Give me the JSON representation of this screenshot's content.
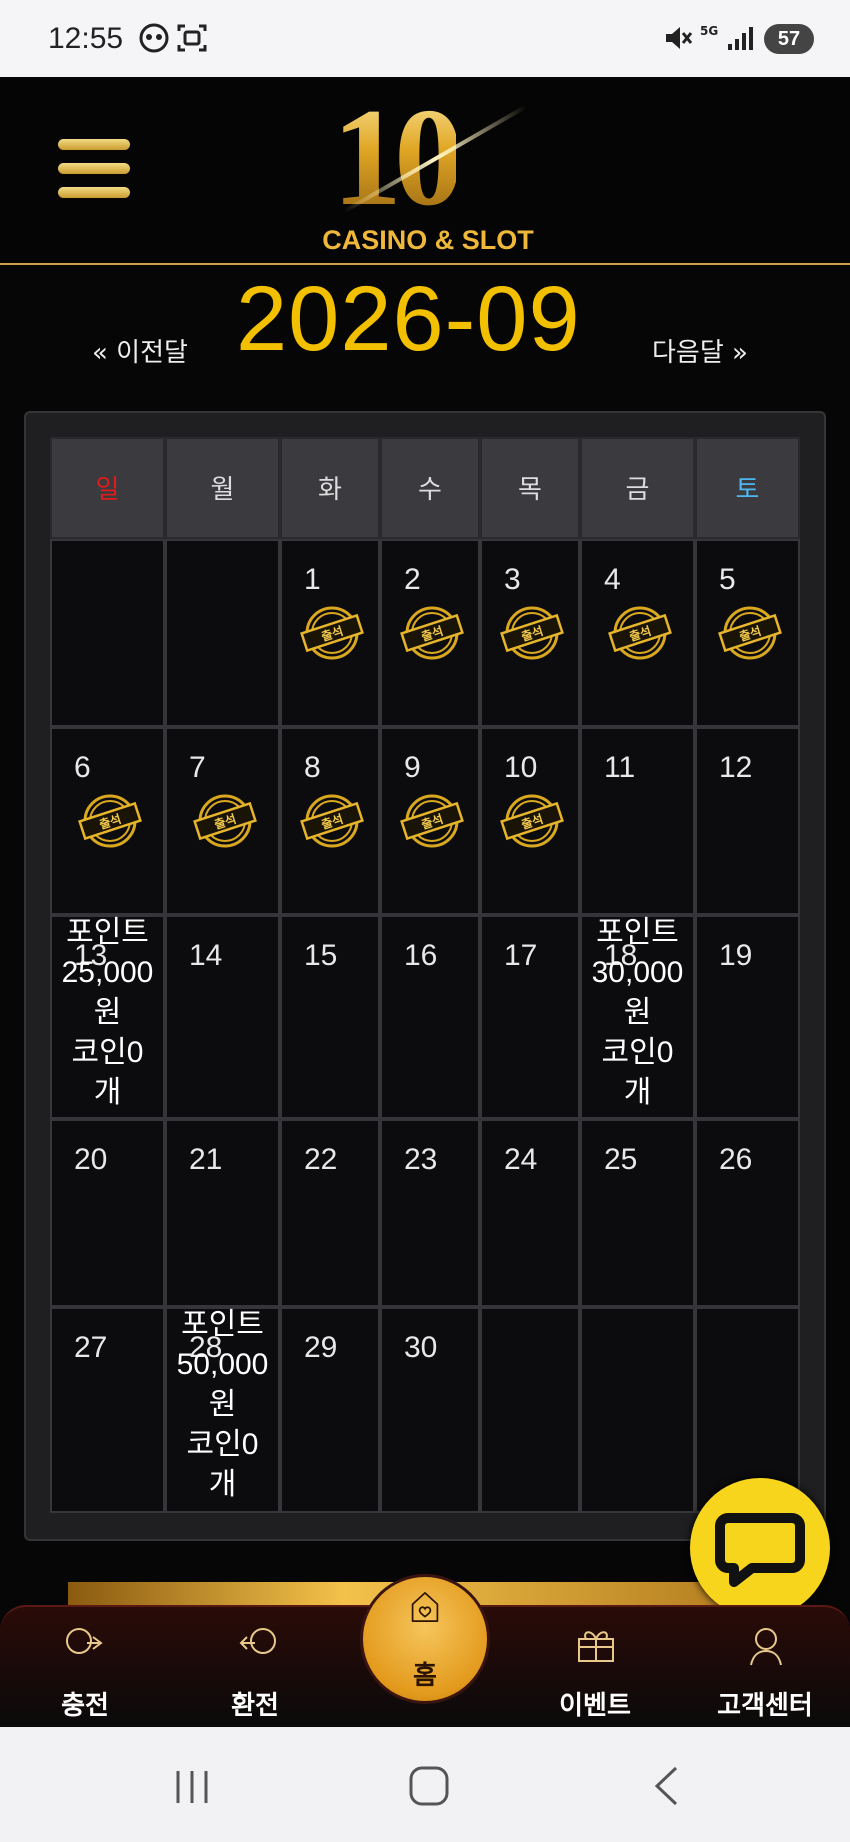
{
  "status_bar": {
    "time": "12:55",
    "battery": "57"
  },
  "header": {
    "logo_number": "10",
    "logo_subtitle": "CASINO & SLOT"
  },
  "month_nav": {
    "prev_label": "« 이전달",
    "title": "2026-09",
    "next_label": "다음달 »"
  },
  "calendar": {
    "weekdays": [
      "일",
      "월",
      "화",
      "수",
      "목",
      "금",
      "토"
    ],
    "weekday_colors": {
      "sun": "#e01b1b",
      "sat": "#4fb6f0",
      "default": "#dddddd"
    },
    "stamp_label": "출석",
    "days": {
      "d1": "1",
      "d2": "2",
      "d3": "3",
      "d4": "4",
      "d5": "5",
      "d6": "6",
      "d7": "7",
      "d8": "8",
      "d9": "9",
      "d10": "10",
      "d11": "11",
      "d12": "12",
      "d13": "13",
      "d14": "14",
      "d15": "15",
      "d16": "16",
      "d17": "17",
      "d18": "18",
      "d19": "19",
      "d20": "20",
      "d21": "21",
      "d22": "22",
      "d23": "23",
      "d24": "24",
      "d25": "25",
      "d26": "26",
      "d27": "27",
      "d28": "28",
      "d29": "29",
      "d30": "30"
    },
    "attended_days": [
      1,
      2,
      3,
      4,
      5,
      6,
      7,
      8,
      9,
      10
    ],
    "rewards": {
      "d13": [
        "포인트",
        "25,000",
        "원",
        "코인0",
        "개"
      ],
      "d18": [
        "포인트",
        "30,000",
        "원",
        "코인0",
        "개"
      ],
      "d28": [
        "포인트",
        "50,000",
        "원",
        "코인0",
        "개"
      ]
    }
  },
  "bottom_nav": {
    "items": [
      {
        "label": "충전",
        "icon": "charge-icon"
      },
      {
        "label": "환전",
        "icon": "exchange-icon"
      },
      {
        "label": "홈",
        "icon": "home-heart-icon"
      },
      {
        "label": "이벤트",
        "icon": "gift-icon"
      },
      {
        "label": "고객센터",
        "icon": "support-icon"
      }
    ]
  },
  "colors": {
    "accent_gold": "#f3c000",
    "background": "#060606",
    "chat_yellow": "#f7d51c"
  }
}
